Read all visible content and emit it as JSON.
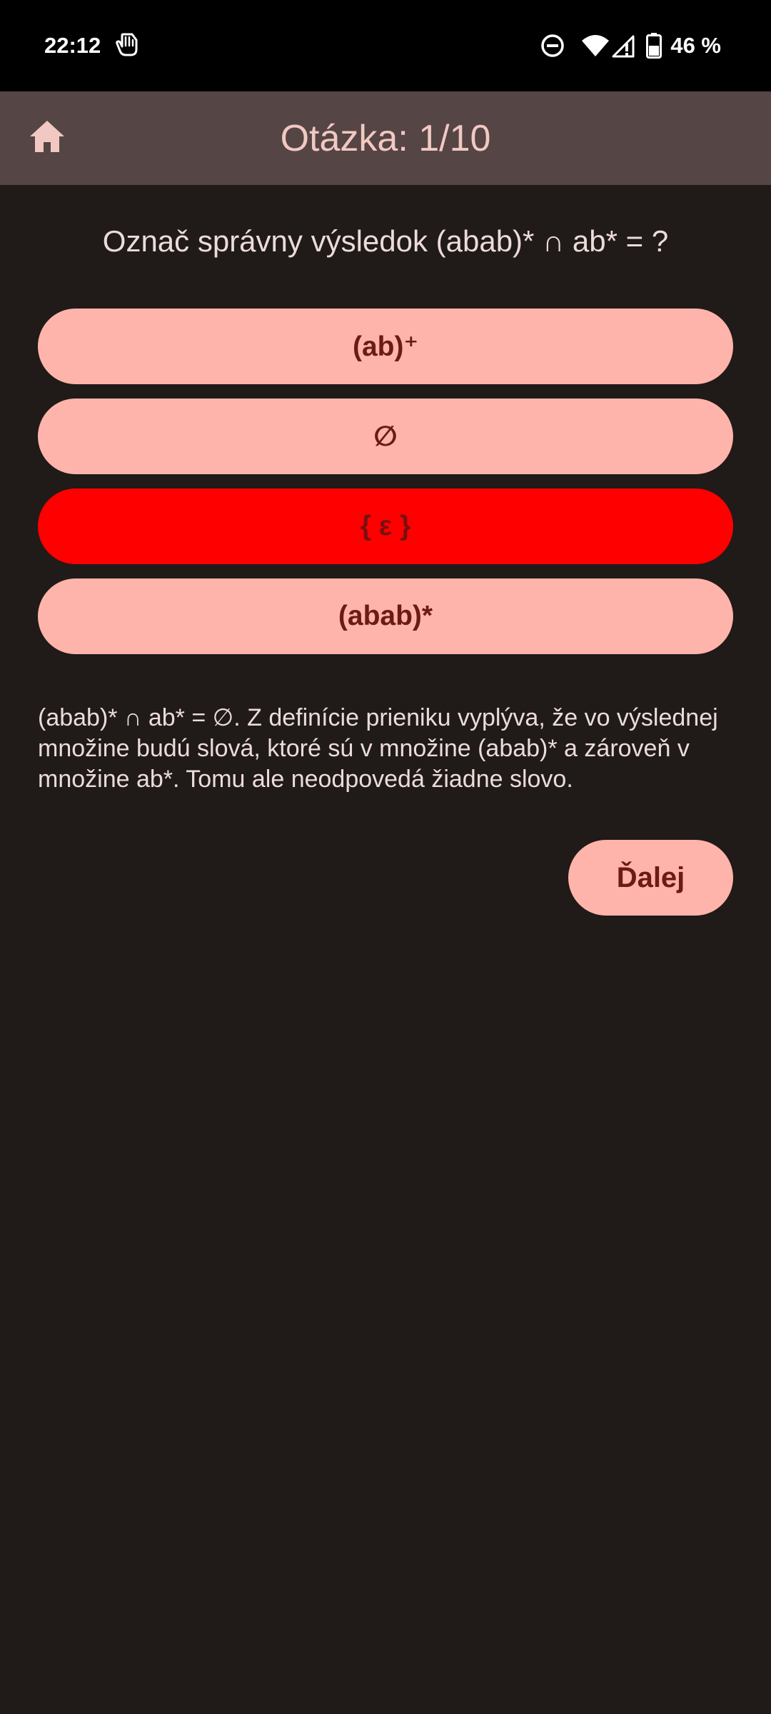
{
  "status_bar": {
    "time": "22:12",
    "battery": "46 %",
    "icons": [
      "hand-touch-icon",
      "do-not-disturb-icon",
      "wifi-icon",
      "signal-icon",
      "battery-icon"
    ]
  },
  "app_bar": {
    "home_icon": "home-icon",
    "title": "Otázka: 1/10"
  },
  "question": {
    "text": "Označ správny výsledok (abab)* ∩ ab* = ?"
  },
  "answers": [
    {
      "label": "(ab)⁺",
      "state": "default"
    },
    {
      "label": "∅",
      "state": "default"
    },
    {
      "label": "{ ε }",
      "state": "selected-wrong"
    },
    {
      "label": "(abab)*",
      "state": "default"
    }
  ],
  "explanation": {
    "text": "(abab)* ∩ ab* = ∅. Z definície prieniku vyplýva, že vo výslednej množine budú slová, ktoré sú v množine (abab)* a zároveň v množine ab*. Tomu ale neodpovedá žiadne slovo."
  },
  "next_button": {
    "label": "Ďalej"
  },
  "colors": {
    "background": "#201a19",
    "app_bar": "#554545",
    "title": "#f2c8c2",
    "answer_bg": "#ffb4ab",
    "answer_text": "#6b1b14",
    "wrong_bg": "#ff0000",
    "body_text": "#ecdcd9"
  }
}
